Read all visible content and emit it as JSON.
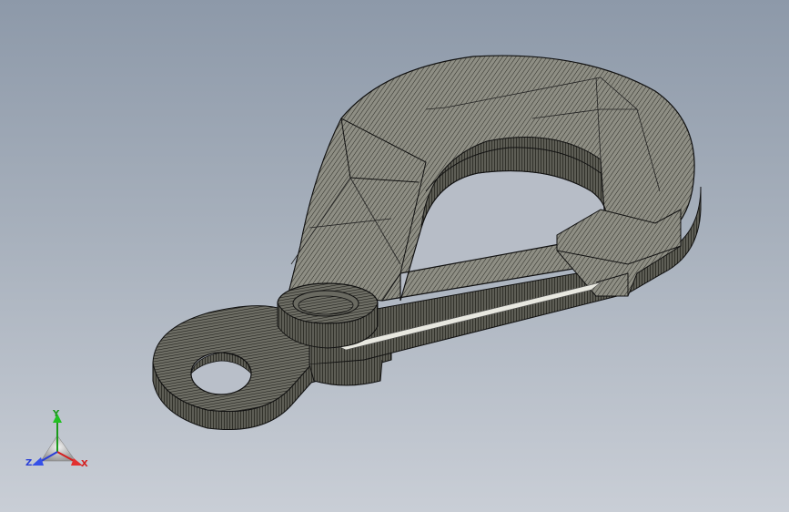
{
  "window": {
    "title": ""
  },
  "colors": {
    "background_top": "#8d99a9",
    "background_bottom": "#c9ced6",
    "model_face": "#8f8f84",
    "model_edge": "#1a1a16",
    "axis_x": "#d42020",
    "axis_y": "#1b9a1b",
    "axis_z": "#2a3fd6"
  },
  "triad": {
    "x_label": "X",
    "y_label": "Y",
    "z_label": "Z"
  },
  "model": {
    "icon": "crane-hook-part",
    "display_style": "shaded-with-edges"
  }
}
